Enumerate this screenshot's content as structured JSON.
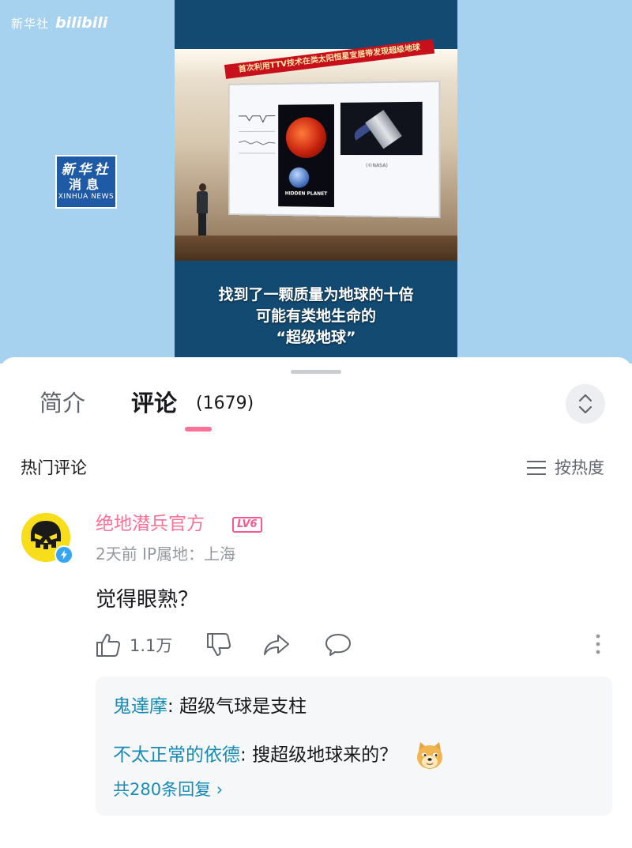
{
  "video": {
    "brand_xinhua": "新华社",
    "brand_bilibili": "bilibili",
    "logo_line1": "新华社",
    "logo_line2": "消息",
    "logo_line3": "XINHUA NEWS",
    "banner": "首次利用TTV技术在类太阳恒星宜居带发现超级地球",
    "poster_text": "HIDDEN PLANET",
    "nasa_caption": "(©NASA)",
    "subtitle_line1": "找到了一颗质量为地球的十倍",
    "subtitle_line2": "可能有类地生命的",
    "subtitle_line3": "“超级地球”"
  },
  "tabs": {
    "intro": "简介",
    "comments": "评论",
    "comment_count": "(1679)"
  },
  "section": {
    "title": "热门评论",
    "sort_label": "按热度"
  },
  "comment": {
    "username": "绝地潜兵官方",
    "level": "LV6",
    "meta": "2天前 IP属地：上海",
    "text": "觉得眼熟？",
    "likes": "1.1万",
    "replies": [
      {
        "name": "鬼達摩",
        "sep": ": ",
        "text": "超级气球是支柱"
      },
      {
        "name": "不太正常的依德",
        "sep": ": ",
        "text": "搜超级地球来的？"
      }
    ],
    "more_replies": "共280条回复 ›"
  },
  "colors": {
    "accent_pink": "#fb7299",
    "link_blue": "#178bb5",
    "video_bg": "#a6d2f0"
  }
}
